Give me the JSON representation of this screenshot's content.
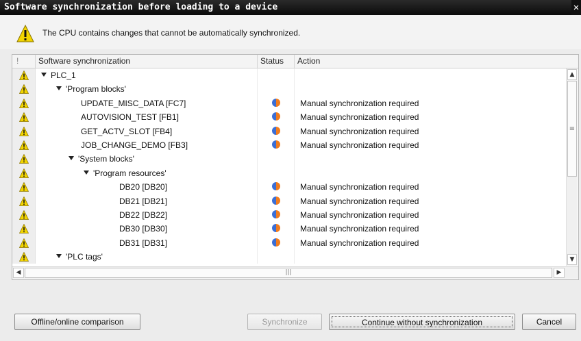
{
  "window": {
    "title": "Software synchronization before loading to a device"
  },
  "message": {
    "text": "The CPU contains changes that cannot be automatically synchronized."
  },
  "table": {
    "columns": {
      "warn": "!",
      "name": "Software synchronization",
      "status": "Status",
      "action": "Action"
    },
    "rows": [
      {
        "name": "PLC_1",
        "action": ""
      },
      {
        "name": "'Program blocks'",
        "action": ""
      },
      {
        "name": "UPDATE_MISC_DATA [FC7]",
        "action": "Manual synchronization required"
      },
      {
        "name": "AUTOVISION_TEST [FB1]",
        "action": "Manual synchronization required"
      },
      {
        "name": "GET_ACTV_SLOT [FB4]",
        "action": "Manual synchronization required"
      },
      {
        "name": "JOB_CHANGE_DEMO [FB3]",
        "action": "Manual synchronization required"
      },
      {
        "name": "'System blocks'",
        "action": ""
      },
      {
        "name": "'Program resources'",
        "action": ""
      },
      {
        "name": "DB20 [DB20]",
        "action": "Manual synchronization required"
      },
      {
        "name": "DB21 [DB21]",
        "action": "Manual synchronization required"
      },
      {
        "name": "DB22 [DB22]",
        "action": "Manual synchronization required"
      },
      {
        "name": "DB30 [DB30]",
        "action": "Manual synchronization required"
      },
      {
        "name": "DB31 [DB31]",
        "action": "Manual synchronization required"
      },
      {
        "name": "'PLC tags'",
        "action": ""
      }
    ]
  },
  "buttons": {
    "comparison": "Offline/online comparison",
    "synchronize": "Synchronize",
    "continue": "Continue without synchronization",
    "cancel": "Cancel"
  },
  "colors": {
    "warning": "#f2d400",
    "status_left": "#3b6fd6",
    "status_right": "#f07c1e"
  }
}
